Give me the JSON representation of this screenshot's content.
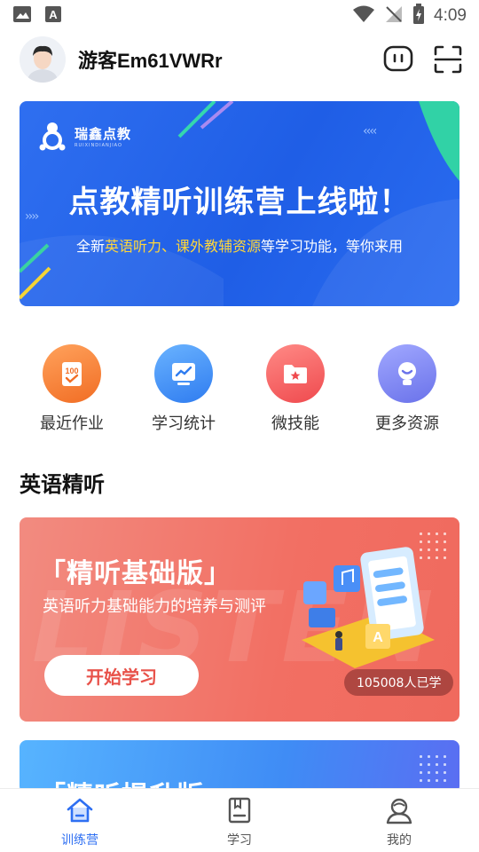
{
  "status_bar": {
    "time": "4:09",
    "icons": [
      "image-icon",
      "font-a-icon",
      "wifi-icon",
      "signal-off-icon",
      "battery-charging-icon"
    ]
  },
  "header": {
    "username": "游客Em61VWRr",
    "actions": [
      "message-icon",
      "scan-icon"
    ]
  },
  "banner": {
    "brand": "瑞鑫点教",
    "brand_sub": "RUIXINDIANJIAO",
    "title": "点教精听训练营上线啦！",
    "subtitle_prefix": "全新",
    "subtitle_highlight": "英语听力、课外教辅资源",
    "subtitle_suffix": "等学习功能，等你来用"
  },
  "quick_menu": [
    {
      "label": "最近作业",
      "icon": "homework-icon",
      "color": "#f5813a"
    },
    {
      "label": "学习统计",
      "icon": "chart-icon",
      "color": "#3f8ef5"
    },
    {
      "label": "微技能",
      "icon": "folder-star-icon",
      "color": "#f2575a"
    },
    {
      "label": "更多资源",
      "icon": "lightbulb-icon",
      "color": "#7c84f0"
    }
  ],
  "section": {
    "title": "英语精听"
  },
  "cards": [
    {
      "title": "「精听基础版」",
      "description": "英语听力基础能力的培养与测评",
      "button": "开始学习",
      "count": "105008人已学",
      "watermark": "LISTEN"
    },
    {
      "title": "「精听提升版」"
    }
  ],
  "bottom_nav": [
    {
      "label": "训练营",
      "icon": "home-icon",
      "active": true
    },
    {
      "label": "学习",
      "icon": "book-icon",
      "active": false
    },
    {
      "label": "我的",
      "icon": "profile-icon",
      "active": false
    }
  ],
  "colors": {
    "accent": "#2e6ff2",
    "banner_bg": "#2466ea",
    "card1_bg": "#f2766a",
    "card2_bg": "#4a9cf7"
  }
}
